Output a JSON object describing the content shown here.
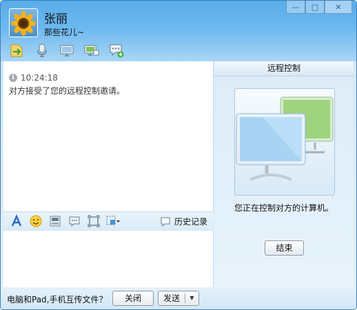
{
  "window": {
    "minimize": "—",
    "maximize": "□",
    "close": "✕"
  },
  "contact": {
    "name": "张丽",
    "signature": "那些花儿~"
  },
  "toolbar": {
    "icons": [
      "file-transfer-icon",
      "microphone-icon",
      "video-icon",
      "remote-desktop-icon",
      "add-chat-icon"
    ]
  },
  "chat": {
    "time": "10:24:18",
    "message": "对方接受了您的远程控制邀请。"
  },
  "format_bar": {
    "icons": [
      "font-icon",
      "emoji-icon",
      "image-icon",
      "message-icon",
      "screenshot-icon",
      "more-icon"
    ],
    "history": "历史记录"
  },
  "remote_panel": {
    "title": "远程控制",
    "status": "您正在控制对方的计算机。",
    "end_button": "结束"
  },
  "bottom": {
    "transfer_link": "电脑和Pad,手机互传文件？",
    "close_button": "关闭",
    "send_button": "发送",
    "send_dropdown": "▼"
  }
}
